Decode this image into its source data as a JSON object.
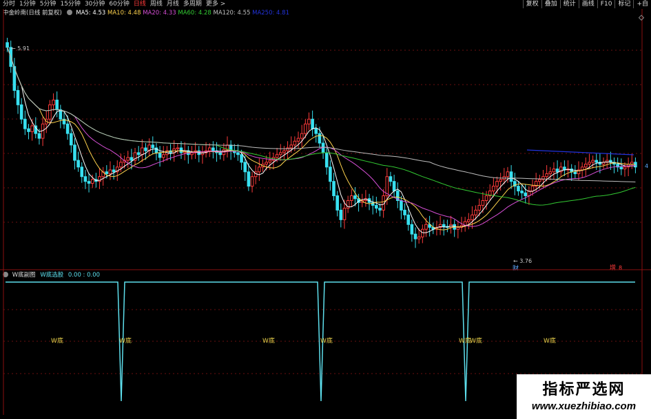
{
  "toolbar": {
    "periods": [
      "分时",
      "1分钟",
      "5分钟",
      "15分钟",
      "30分钟",
      "60分钟",
      "日线",
      "周线",
      "月线",
      "多周期",
      "更多 >"
    ],
    "active_period": "日线",
    "tools": [
      "复权",
      "叠加",
      "统计",
      "画线",
      "F10",
      "标记",
      "+自"
    ]
  },
  "main_legend": {
    "stock": "中金岭南(日线 前复权)",
    "ma5": "MA5: 4.53",
    "ma10": "MA10: 4.48",
    "ma20": "MA20: 4.33",
    "ma60": "MA60: 4.28",
    "ma120": "MA120: 4.55",
    "ma250": "MA250: 4.81"
  },
  "colors": {
    "up": "#ff3b3b",
    "down": "#38e0f0",
    "ma5": "#ffffff",
    "ma10": "#ffd34d",
    "ma20": "#d64fd6",
    "ma60": "#33cc33",
    "ma120": "#bfbfbf",
    "ma250": "#2233dd",
    "wline": "#5ee0ee",
    "wlabel": "#e8d14a",
    "grid": "#6b1010"
  },
  "chart_data": {
    "type": "candlestick",
    "x": [
      1,
      2,
      3,
      4,
      5,
      6,
      7,
      8,
      9,
      10,
      11,
      12,
      13,
      14,
      15,
      16,
      17,
      18,
      19,
      20,
      21,
      22,
      23,
      24,
      25,
      26,
      27,
      28,
      29,
      30,
      31,
      32,
      33,
      34,
      35,
      36,
      37,
      38,
      39,
      40,
      41,
      42,
      43,
      44,
      45,
      46,
      47,
      48,
      49,
      50,
      51,
      52,
      53,
      54,
      55,
      56,
      57,
      58,
      59,
      60,
      61,
      62,
      63,
      64,
      65,
      66,
      67,
      68,
      69,
      70,
      71,
      72,
      73,
      74,
      75,
      76,
      77,
      78,
      79,
      80,
      81,
      82,
      83,
      84,
      85,
      86,
      87,
      88,
      89,
      90,
      91,
      92,
      93,
      94,
      95,
      96,
      97,
      98,
      99,
      100,
      101,
      102,
      103,
      104,
      105,
      106,
      107,
      108,
      109,
      110,
      111,
      112,
      113,
      114,
      115,
      116,
      117,
      118,
      119,
      120,
      121,
      122,
      123,
      124,
      125,
      126,
      127,
      128,
      129,
      130,
      131,
      132,
      133,
      134,
      135,
      136,
      137,
      138,
      139,
      140,
      141,
      142,
      143,
      144,
      145,
      146,
      147,
      148,
      149,
      150,
      151,
      152,
      153,
      154,
      155,
      156,
      157,
      158,
      159,
      160,
      161,
      162,
      163,
      164,
      165,
      166,
      167,
      168,
      169,
      170,
      171,
      172,
      173,
      174,
      175,
      176,
      177,
      178,
      179,
      180
    ],
    "close": [
      5.8,
      5.6,
      5.35,
      5.2,
      5.05,
      4.95,
      4.92,
      4.98,
      4.9,
      4.85,
      5.0,
      5.05,
      5.2,
      5.25,
      5.15,
      5.05,
      5.0,
      4.9,
      4.78,
      4.62,
      4.55,
      4.45,
      4.4,
      4.38,
      4.42,
      4.4,
      4.45,
      4.5,
      4.48,
      4.52,
      4.5,
      4.55,
      4.6,
      4.62,
      4.65,
      4.62,
      4.7,
      4.68,
      4.75,
      4.72,
      4.78,
      4.75,
      4.7,
      4.65,
      4.68,
      4.72,
      4.7,
      4.74,
      4.75,
      4.7,
      4.72,
      4.68,
      4.7,
      4.72,
      4.68,
      4.7,
      4.72,
      4.75,
      4.72,
      4.7,
      4.68,
      4.73,
      4.78,
      4.72,
      4.7,
      4.68,
      4.6,
      4.5,
      4.35,
      4.45,
      4.5,
      4.55,
      4.58,
      4.6,
      4.62,
      4.65,
      4.68,
      4.7,
      4.72,
      4.75,
      4.78,
      4.82,
      4.85,
      4.9,
      5.0,
      5.05,
      4.95,
      4.9,
      4.8,
      4.7,
      4.55,
      4.4,
      4.25,
      4.1,
      4.0,
      4.12,
      4.2,
      4.25,
      4.22,
      4.18,
      4.2,
      4.22,
      4.18,
      4.15,
      4.12,
      4.1,
      4.25,
      4.45,
      4.4,
      4.3,
      4.2,
      4.1,
      4.05,
      3.95,
      3.85,
      3.8,
      3.82,
      3.9,
      3.95,
      3.92,
      3.9,
      3.92,
      3.95,
      3.93,
      3.92,
      3.95,
      3.9,
      3.92,
      3.94,
      3.98,
      4.0,
      4.05,
      4.1,
      4.15,
      4.2,
      4.25,
      4.3,
      4.35,
      4.4,
      4.42,
      4.45,
      4.5,
      4.4,
      4.35,
      4.3,
      4.28,
      4.25,
      4.3,
      4.35,
      4.4,
      4.42,
      4.45,
      4.48,
      4.5,
      4.53,
      4.5,
      4.55,
      4.52,
      4.53,
      4.5,
      4.48,
      4.52,
      4.55,
      4.58,
      4.6,
      4.62,
      4.6,
      4.58,
      4.6,
      4.62,
      4.6,
      4.58,
      4.55,
      4.53,
      4.55,
      4.58,
      4.6,
      4.55
    ],
    "price_labels": {
      "high": "5.91",
      "low": "3.76"
    },
    "annotations": [
      "财",
      "增",
      "8"
    ],
    "sub_indicator": {
      "title": "W底副图",
      "name": "W底选股",
      "value": "0.00 : 0.00",
      "signal_x": [
        43,
        114,
        165
      ],
      "label": "W底",
      "label_x": [
        20,
        43,
        96,
        117,
        168,
        172,
        200
      ]
    }
  },
  "axis": {
    "left_ticks": [
      "5.91",
      "",
      "",
      "",
      "",
      "",
      "",
      "",
      ""
    ],
    "right_mark": "4"
  },
  "watermark": {
    "title": "指标严选网",
    "url": "www.xuezhibiao.com"
  }
}
